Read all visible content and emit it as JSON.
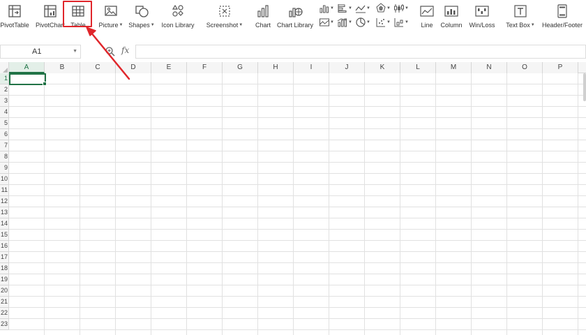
{
  "ribbon": {
    "buttons": [
      {
        "id": "pivottable",
        "label": "PivotTable",
        "icon": "pivottable-icon"
      },
      {
        "id": "pivotchart",
        "label": "PivotChart",
        "icon": "pivotchart-icon"
      },
      {
        "id": "table",
        "label": "Table",
        "icon": "table-icon"
      },
      {
        "id": "picture",
        "label": "Picture",
        "icon": "picture-icon"
      },
      {
        "id": "shapes",
        "label": "Shapes",
        "icon": "shapes-icon"
      },
      {
        "id": "icon-library",
        "label": "Icon Library",
        "icon": "icon-library-icon"
      },
      {
        "id": "screenshot",
        "label": "Screenshot",
        "icon": "screenshot-icon"
      },
      {
        "id": "chart",
        "label": "Chart",
        "icon": "chart-icon"
      },
      {
        "id": "chart-library",
        "label": "Chart Library",
        "icon": "chart-library-icon"
      },
      {
        "id": "line",
        "label": "Line",
        "icon": "sparkline-line-icon"
      },
      {
        "id": "column",
        "label": "Column",
        "icon": "sparkline-column-icon"
      },
      {
        "id": "winloss",
        "label": "Win/Loss",
        "icon": "sparkline-winloss-icon"
      },
      {
        "id": "textbox",
        "label": "Text Box",
        "icon": "text-box-icon"
      },
      {
        "id": "headerfooter",
        "label": "Header/Footer",
        "icon": "header-footer-icon"
      }
    ],
    "highlighted": "Table",
    "accent_color": "#e0262b"
  },
  "formula_bar": {
    "name_box": "A1",
    "fx_label": "fx",
    "formula_value": ""
  },
  "sheet": {
    "columns": [
      "A",
      "B",
      "C",
      "D",
      "E",
      "F",
      "G",
      "H",
      "I",
      "J",
      "K",
      "L",
      "M",
      "N",
      "O",
      "P"
    ],
    "rows": [
      "1",
      "2",
      "3",
      "4",
      "5",
      "6",
      "7",
      "8",
      "9",
      "10",
      "11",
      "12",
      "13",
      "14",
      "15",
      "16",
      "17",
      "18",
      "19",
      "20",
      "21",
      "22",
      "23"
    ],
    "active_cell": "A1",
    "selection_color": "#217346"
  }
}
